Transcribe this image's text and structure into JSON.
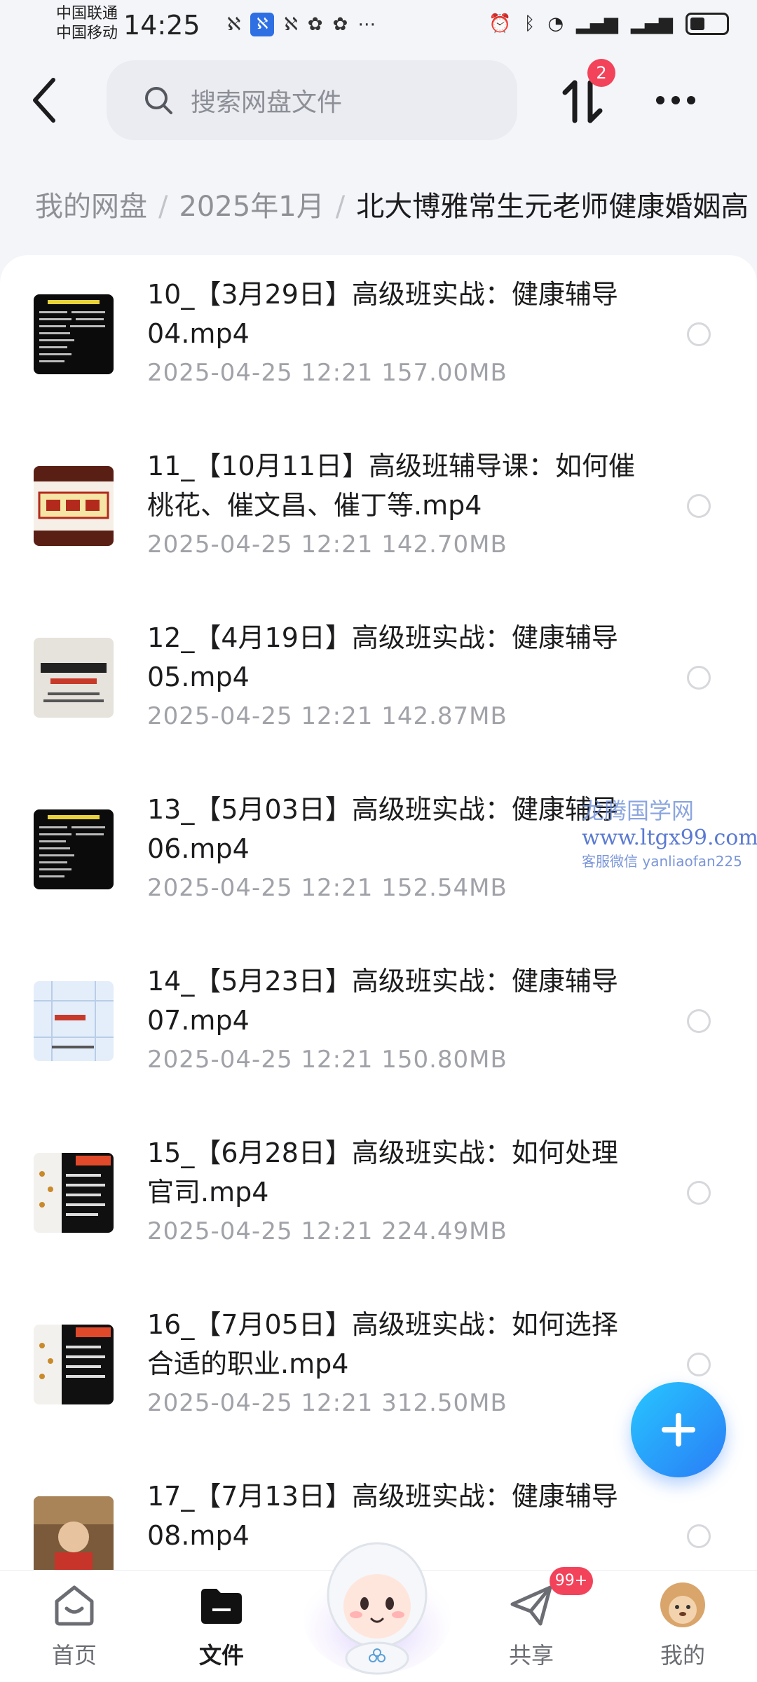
{
  "status_bar": {
    "carrier1": "中国联通",
    "carrier2": "中国移动",
    "time": "14:25"
  },
  "search": {
    "placeholder": "搜索网盘文件"
  },
  "transfer_badge": "2",
  "breadcrumb": {
    "items": [
      "我的网盘",
      "2025年1月"
    ],
    "current": "北大博雅常生元老师健康婚姻高"
  },
  "files": [
    {
      "name": "10_【3月29日】高级班实战：健康辅导04.mp4",
      "date": "2025-04-25  12:21",
      "size": "157.00MB"
    },
    {
      "name": "11_【10月11日】高级班辅导课：如何催桃花、催文昌、催丁等.mp4",
      "date": "2025-04-25  12:21",
      "size": "142.70MB"
    },
    {
      "name": "12_【4月19日】高级班实战：健康辅导05.mp4",
      "date": "2025-04-25  12:21",
      "size": "142.87MB"
    },
    {
      "name": "13_【5月03日】高级班实战：健康辅导06.mp4",
      "date": "2025-04-25  12:21",
      "size": "152.54MB"
    },
    {
      "name": "14_【5月23日】高级班实战：健康辅导07.mp4",
      "date": "2025-04-25  12:21",
      "size": "150.80MB"
    },
    {
      "name": "15_【6月28日】高级班实战：如何处理官司.mp4",
      "date": "2025-04-25  12:21",
      "size": "224.49MB"
    },
    {
      "name": "16_【7月05日】高级班实战：如何选择合适的职业.mp4",
      "date": "2025-04-25  12:21",
      "size": "312.50MB"
    },
    {
      "name": "17_【7月13日】高级班实战：健康辅导08.mp4",
      "date": "",
      "size": ""
    }
  ],
  "watermark": {
    "line1": "龙腾国学网",
    "line2": "www.ltgx99.com",
    "line3": "客服微信 yanliaofan225"
  },
  "nav": {
    "home": "首页",
    "files": "文件",
    "share": "共享",
    "mine": "我的",
    "share_badge": "99+"
  }
}
